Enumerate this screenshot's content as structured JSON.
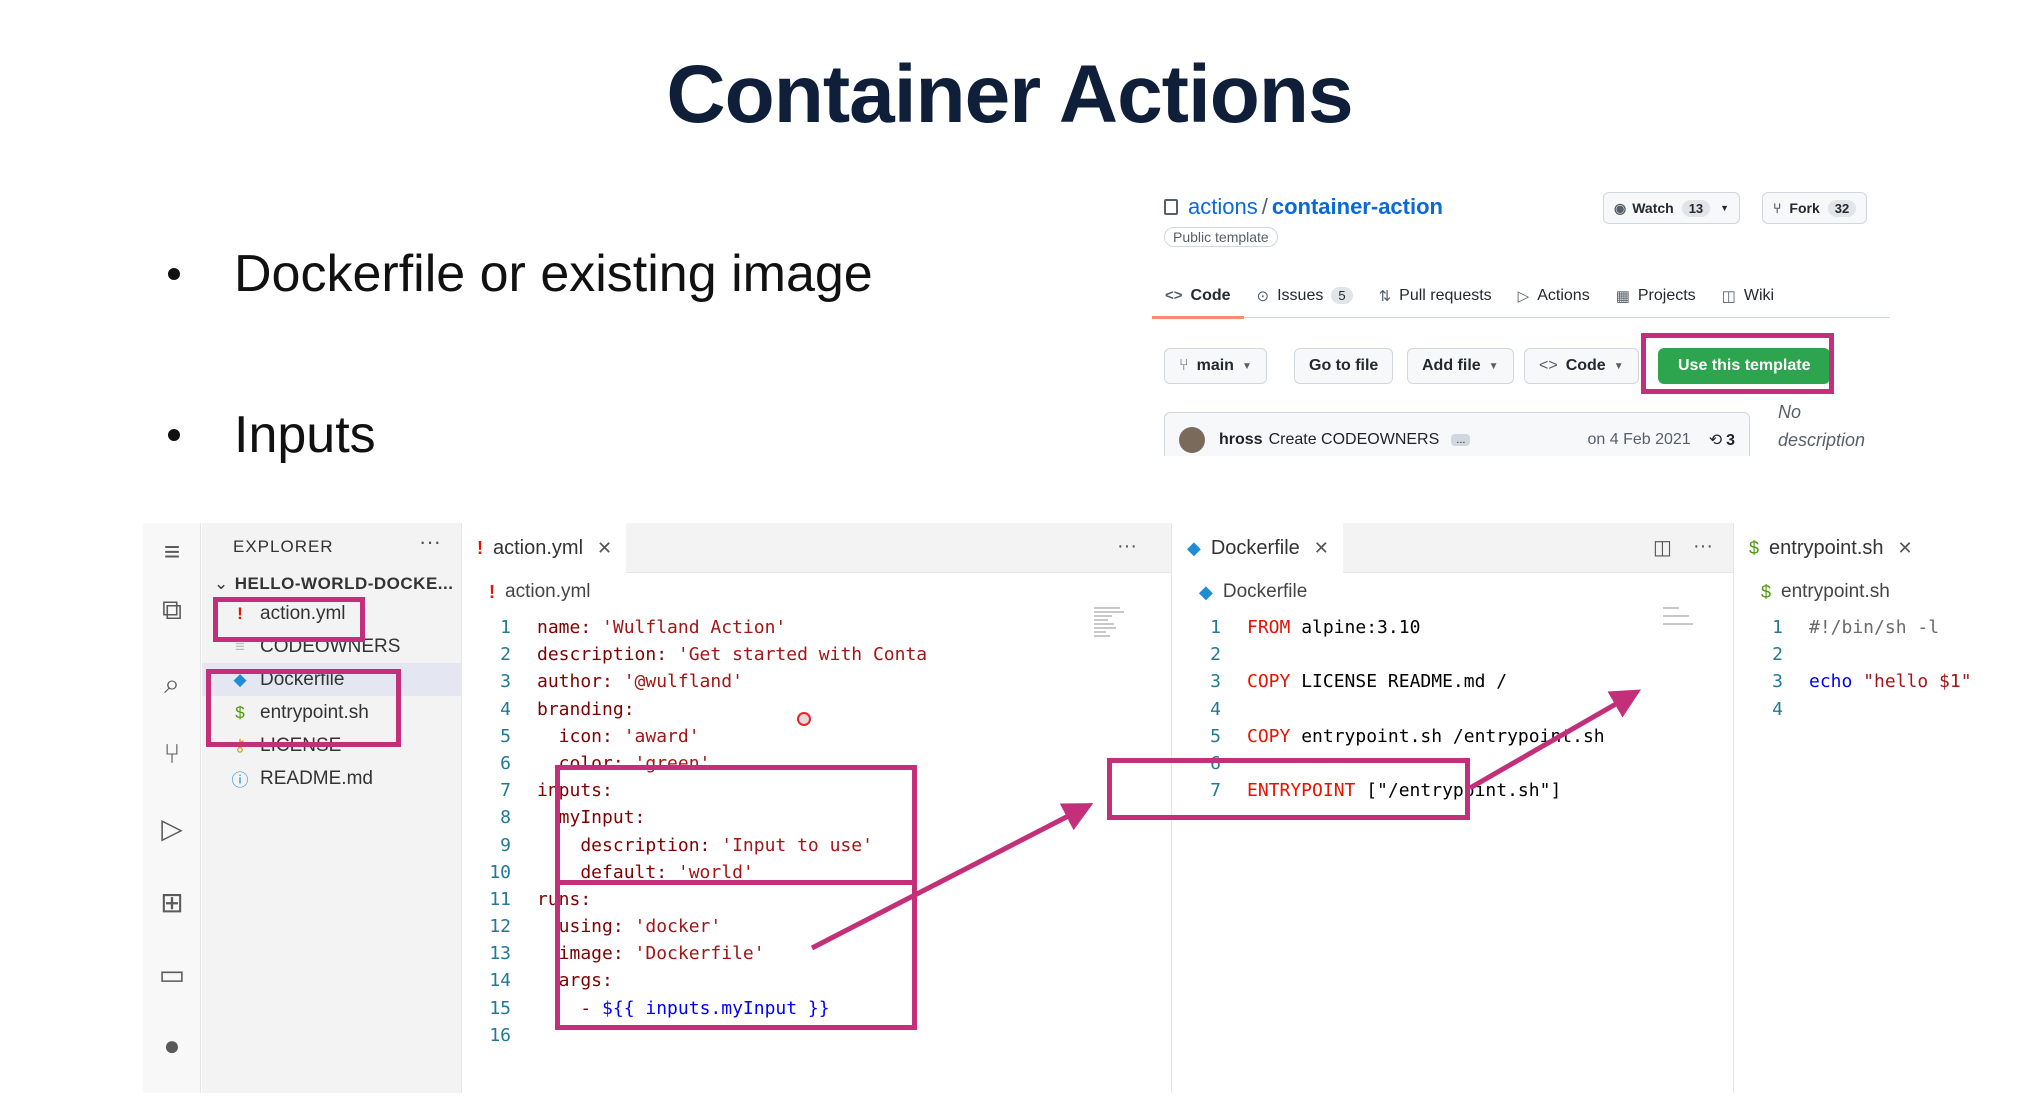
{
  "slide": {
    "title": "Container Actions",
    "bullets": [
      "Dockerfile or existing image",
      "Inputs"
    ]
  },
  "github": {
    "owner": "actions",
    "separator": "/",
    "repo": "container-action",
    "badge": "Public template",
    "watch_label": "Watch",
    "watch_count": "13",
    "fork_label": "Fork",
    "fork_count": "32",
    "tabs": [
      {
        "icon": "<>",
        "label": "Code",
        "count": ""
      },
      {
        "icon": "⊙",
        "label": "Issues",
        "count": "5"
      },
      {
        "icon": "⇅",
        "label": "Pull requests",
        "count": ""
      },
      {
        "icon": "▷",
        "label": "Actions",
        "count": ""
      },
      {
        "icon": "▦",
        "label": "Projects",
        "count": ""
      },
      {
        "icon": "◫",
        "label": "Wiki",
        "count": ""
      }
    ],
    "branch": "main",
    "go_to_file": "Go to file",
    "add_file": "Add file",
    "code_btn": "Code",
    "use_template": "Use this template",
    "commit": {
      "author": "hross",
      "message": "Create CODEOWNERS",
      "dots": "...",
      "date": "on 4 Feb 2021",
      "history": "3"
    },
    "no_description": "No description provided."
  },
  "vscode": {
    "explorer_title": "EXPLORER",
    "more": "···",
    "folder": "HELLO-WORLD-DOCKE...",
    "files": [
      {
        "icon": "!",
        "name": "action.yml",
        "color": "#e51400"
      },
      {
        "icon": "≡",
        "name": "CODEOWNERS",
        "color": "#bbbbbb"
      },
      {
        "icon": "🐳",
        "name": "Dockerfile",
        "color": "#1f8dd6"
      },
      {
        "icon": "$",
        "name": "entrypoint.sh",
        "color": "#4d9a06"
      },
      {
        "icon": "⚷",
        "name": "LICENSE",
        "color": "#c9a12c"
      },
      {
        "icon": "ⓘ",
        "name": "README.md",
        "color": "#1f8dd6"
      }
    ],
    "editors": [
      {
        "tab": "action.yml",
        "crumb": "action.yml",
        "lines": [
          {
            "n": "1",
            "key": "name:",
            "val": " 'Wulfland Action'"
          },
          {
            "n": "2",
            "key": "description:",
            "val": " 'Get started with Conta"
          },
          {
            "n": "3",
            "key": "author:",
            "val": " '@wulfland'"
          },
          {
            "n": "4",
            "key": "branding:",
            "val": ""
          },
          {
            "n": "5",
            "key": "  icon:",
            "val": " 'award'"
          },
          {
            "n": "6",
            "key": "  color:",
            "val": " 'green'"
          },
          {
            "n": "7",
            "key": "inputs:",
            "val": ""
          },
          {
            "n": "8",
            "key": "  myInput:",
            "val": ""
          },
          {
            "n": "9",
            "key": "    description:",
            "val": " 'Input to use'"
          },
          {
            "n": "10",
            "key": "    default:",
            "val": " 'world'"
          },
          {
            "n": "11",
            "key": "runs:",
            "val": ""
          },
          {
            "n": "12",
            "key": "  using:",
            "val": " 'docker'"
          },
          {
            "n": "13",
            "key": "  image:",
            "val": " 'Dockerfile'"
          },
          {
            "n": "14",
            "key": "  args:",
            "val": ""
          },
          {
            "n": "15",
            "key": "    - ",
            "val": "${{ inputs.myInput }}"
          },
          {
            "n": "16",
            "key": "",
            "val": ""
          }
        ]
      },
      {
        "tab": "Dockerfile",
        "crumb": "Dockerfile",
        "lines": [
          {
            "n": "1",
            "kw": "FROM",
            "rest": " alpine:3.10"
          },
          {
            "n": "2",
            "kw": "",
            "rest": ""
          },
          {
            "n": "3",
            "kw": "COPY",
            "rest": " LICENSE README.md /"
          },
          {
            "n": "4",
            "kw": "",
            "rest": ""
          },
          {
            "n": "5",
            "kw": "COPY",
            "rest": " entrypoint.sh /entrypoint.sh"
          },
          {
            "n": "6",
            "kw": "",
            "rest": ""
          },
          {
            "n": "7",
            "kw": "ENTRYPOINT",
            "rest": " [\"/entrypoint.sh\"]"
          }
        ]
      },
      {
        "tab": "entrypoint.sh",
        "crumb": "entrypoint.sh",
        "lines": [
          {
            "n": "1",
            "kw": "",
            "rest": "#!/bin/sh -l"
          },
          {
            "n": "2",
            "kw": "",
            "rest": ""
          },
          {
            "n": "3",
            "kw": "echo",
            "rest": " \"hello $1\""
          },
          {
            "n": "4",
            "kw": "",
            "rest": ""
          }
        ]
      }
    ]
  },
  "colors": {
    "highlight": "#c42f7a",
    "title": "#0f1f3a",
    "github_green": "#2da44e",
    "github_link": "#0969da"
  }
}
